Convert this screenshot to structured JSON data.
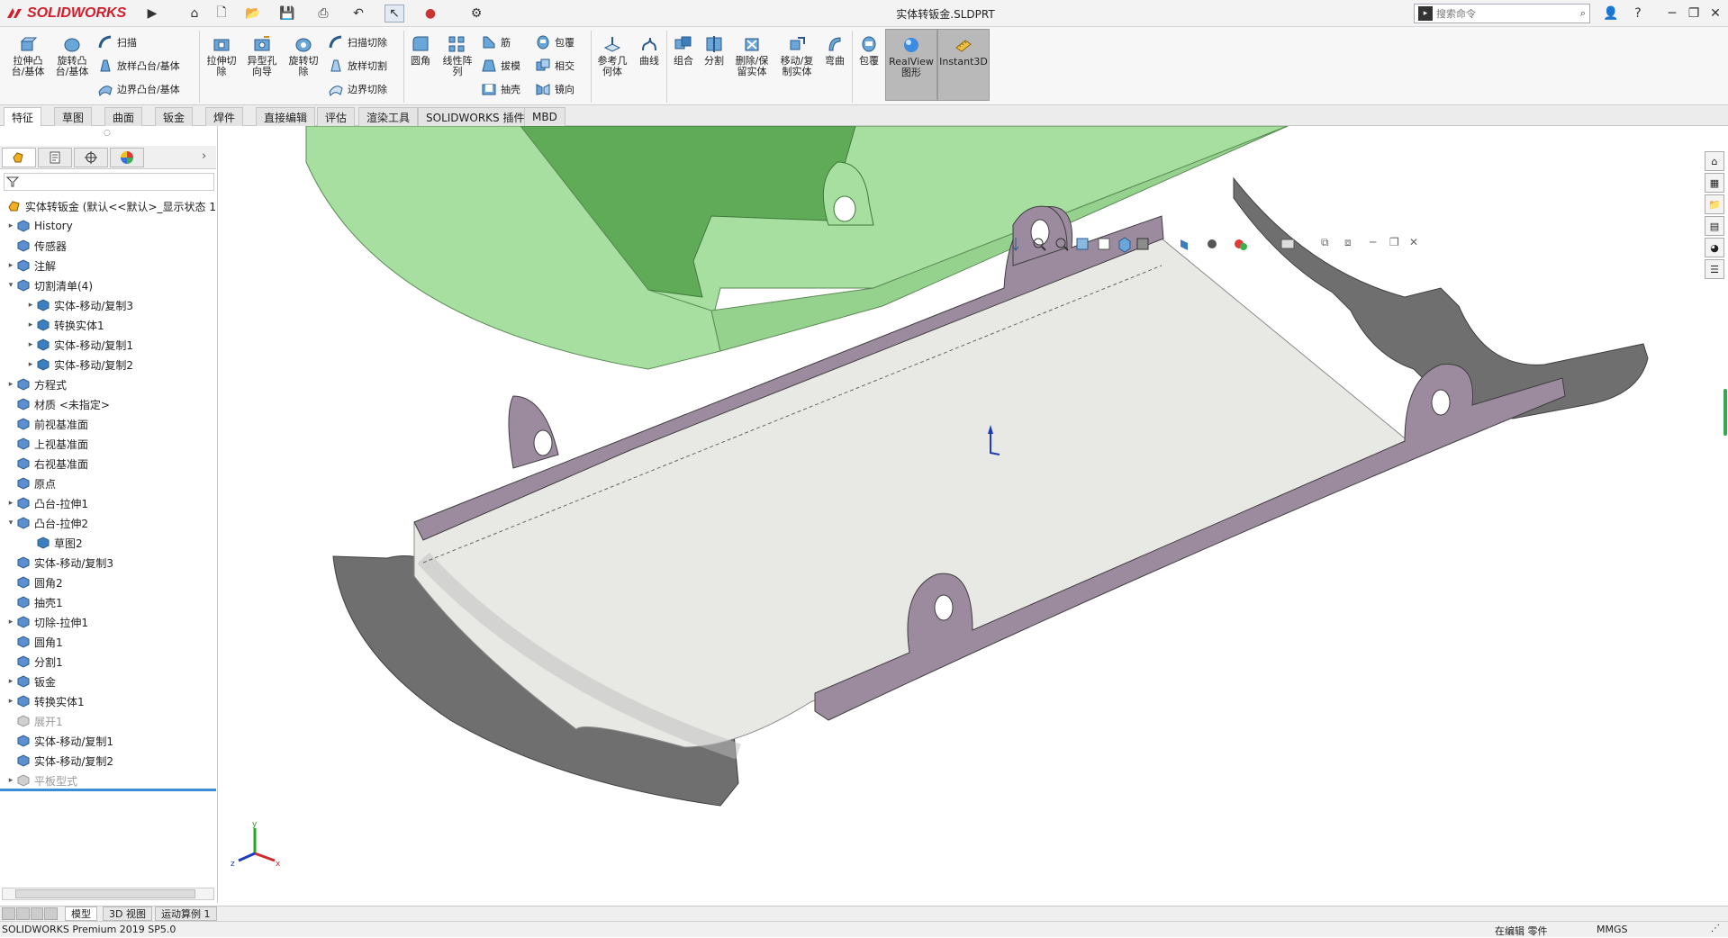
{
  "app": {
    "brand": "SOLIDWORKS",
    "window_title": "实体转钣金.SLDPRT"
  },
  "search": {
    "placeholder": "搜索命令"
  },
  "toolbar": {
    "extrude_boss": "拉伸凸\n台/基体",
    "revolve_boss": "旋转凸\n台/基体",
    "sweep": "扫描",
    "loft_boss": "放样凸台/基体",
    "boundary_boss": "边界凸台/基体",
    "extrude_cut": "拉伸切\n除",
    "hole_wizard": "异型孔\n向导",
    "revolve_cut": "旋转切\n除",
    "sweep_cut": "扫描切除",
    "loft_cut": "放样切割",
    "boundary_cut": "边界切除",
    "fillet": "圆角",
    "linear_pattern": "线性阵\n列",
    "rib": "筋",
    "draft": "拔模",
    "shell": "抽壳",
    "wrap": "包覆",
    "intersect": "相交",
    "mirror": "镜向",
    "ref_geometry": "参考几\n何体",
    "curves": "曲线",
    "combine": "组合",
    "split": "分割",
    "delete_keep_body": "删除/保\n留实体",
    "move_copy_body": "移动/复\n制实体",
    "flex": "弯曲",
    "wrap2": "包覆",
    "realview": "RealView\n图形",
    "instant3d": "Instant3D"
  },
  "tabs": [
    "特征",
    "草图",
    "曲面",
    "钣金",
    "焊件",
    "直接编辑",
    "评估",
    "渲染工具",
    "SOLIDWORKS 插件",
    "MBD"
  ],
  "tree": {
    "root": "实体转钣金 (默认<<默认>_显示状态 1",
    "items": [
      {
        "label": "History",
        "level": 0,
        "arrow": "▸"
      },
      {
        "label": "传感器",
        "level": 0,
        "arrow": ""
      },
      {
        "label": "注解",
        "level": 0,
        "arrow": "▸"
      },
      {
        "label": "切割清单(4)",
        "level": 0,
        "arrow": "▾"
      },
      {
        "label": "实体-移动/复制3",
        "level": 1,
        "arrow": "▸"
      },
      {
        "label": "转换实体1",
        "level": 1,
        "arrow": "▸"
      },
      {
        "label": "实体-移动/复制1",
        "level": 1,
        "arrow": "▸"
      },
      {
        "label": "实体-移动/复制2",
        "level": 1,
        "arrow": "▸"
      },
      {
        "label": "方程式",
        "level": 0,
        "arrow": "▸"
      },
      {
        "label": "材质 <未指定>",
        "level": 0,
        "arrow": ""
      },
      {
        "label": "前视基准面",
        "level": 0,
        "arrow": ""
      },
      {
        "label": "上视基准面",
        "level": 0,
        "arrow": ""
      },
      {
        "label": "右视基准面",
        "level": 0,
        "arrow": ""
      },
      {
        "label": "原点",
        "level": 0,
        "arrow": ""
      },
      {
        "label": "凸台-拉伸1",
        "level": 0,
        "arrow": "▸"
      },
      {
        "label": "凸台-拉伸2",
        "level": 0,
        "arrow": "▾"
      },
      {
        "label": "草图2",
        "level": 1,
        "arrow": ""
      },
      {
        "label": "实体-移动/复制3",
        "level": 0,
        "arrow": ""
      },
      {
        "label": "圆角2",
        "level": 0,
        "arrow": ""
      },
      {
        "label": "抽壳1",
        "level": 0,
        "arrow": ""
      },
      {
        "label": "切除-拉伸1",
        "level": 0,
        "arrow": "▸"
      },
      {
        "label": "圆角1",
        "level": 0,
        "arrow": ""
      },
      {
        "label": "分割1",
        "level": 0,
        "arrow": ""
      },
      {
        "label": "钣金",
        "level": 0,
        "arrow": "▸"
      },
      {
        "label": "转换实体1",
        "level": 0,
        "arrow": "▸"
      },
      {
        "label": "展开1",
        "level": 0,
        "arrow": "",
        "dim": true
      },
      {
        "label": "实体-移动/复制1",
        "level": 0,
        "arrow": ""
      },
      {
        "label": "实体-移动/复制2",
        "level": 0,
        "arrow": ""
      },
      {
        "label": "平板型式",
        "level": 0,
        "arrow": "▸",
        "dim": true
      }
    ]
  },
  "bottom_tabs": [
    "模型",
    "3D 视图",
    "运动算例 1"
  ],
  "status": {
    "product": "SOLIDWORKS Premium 2019 SP5.0",
    "mode": "在编辑 零件",
    "units": "MMGS"
  },
  "colors": {
    "brand_red": "#d21d2b",
    "body_green": "#a7dfa0",
    "sheet_purple": "#9c8b9e",
    "tray_white": "#e8e8e4",
    "side_gray": "#6f6f6f"
  },
  "axis": {
    "x": "x",
    "y": "y",
    "z": "z"
  }
}
